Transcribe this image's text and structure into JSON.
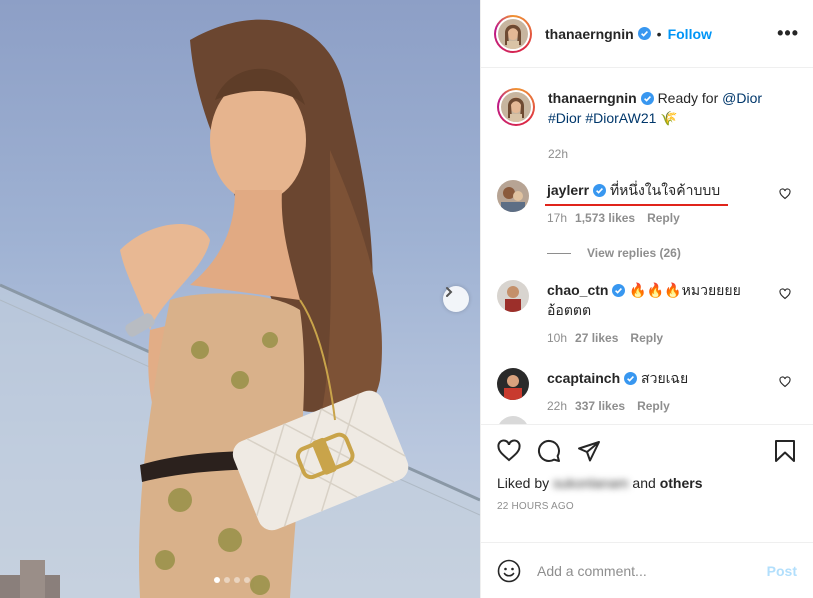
{
  "header": {
    "username": "thanaerngnin",
    "separator": "•",
    "follow_label": "Follow",
    "more_label": "•••"
  },
  "caption": {
    "username": "thanaerngnin",
    "text": "Ready for ",
    "mention": "@Dior",
    "hashtags": "#Dior #DiorAW21",
    "emoji": "🌾",
    "time": "22h"
  },
  "comments": [
    {
      "username": "jaylerr",
      "verified": true,
      "text": "ที่หนึ่งในใจค้าบบบ",
      "time": "17h",
      "likes": "1,573 likes",
      "reply": "Reply"
    },
    {
      "username": "chao_ctn",
      "verified": true,
      "text": "🔥🔥🔥หมวยยยย อ้อตตต",
      "time": "10h",
      "likes": "27 likes",
      "reply": "Reply"
    },
    {
      "username": "ccaptainch",
      "verified": true,
      "text": "สวยเฉย",
      "time": "22h",
      "likes": "337 likes",
      "reply": "Reply"
    }
  ],
  "view_replies": "View replies (26)",
  "likes": {
    "prefix": "Liked by ",
    "user": "sukonlanam",
    "suffix": " and ",
    "others": "others"
  },
  "timestamp": "22 HOURS AGO",
  "add_comment": {
    "placeholder": "Add a comment...",
    "post_label": "Post"
  },
  "colors": {
    "follow": "#0095f6",
    "verified": "#3897f0",
    "post_disabled": "#b2dffc",
    "annotation": "#e0241b"
  },
  "icons": [
    "heart-icon",
    "comment-icon",
    "share-icon",
    "bookmark-icon",
    "emoji-icon",
    "chevron-right-icon",
    "verified-badge-icon",
    "more-icon"
  ]
}
